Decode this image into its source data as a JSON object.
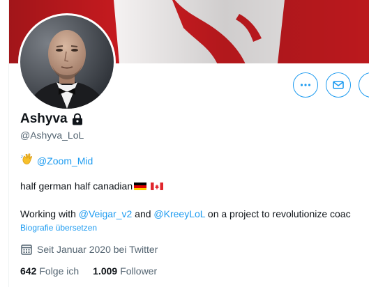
{
  "profile": {
    "display_name": "Ashyva",
    "handle": "@Ashyva_LoL",
    "mention": "@Zoom_Mid",
    "bio_line1": "half german half canadian",
    "bio_line2_prefix": "Working with ",
    "bio_mention1": "@Veigar_v2",
    "bio_and": " and ",
    "bio_mention2": "@KreeyLoL",
    "bio_line2_suffix": " on a project to revolutionize coac",
    "translate_link": "Biografie übersetzen",
    "joined": "Seit Januar 2020 bei Twitter",
    "following_count": "642",
    "following_label": "Folge ich",
    "followers_count": "1.009",
    "followers_label": "Follower"
  },
  "icons": {
    "more": "more-dots-icon",
    "message": "envelope-icon",
    "lock": "lock-icon",
    "calendar": "calendar-icon",
    "wave": "waving-hand-emoji",
    "flag_de": "germany-flag-emoji",
    "flag_ca": "canada-flag-emoji"
  },
  "colors": {
    "accent": "#1d9bf0",
    "secondary_text": "#536471",
    "banner_red": "#c81a1f"
  }
}
